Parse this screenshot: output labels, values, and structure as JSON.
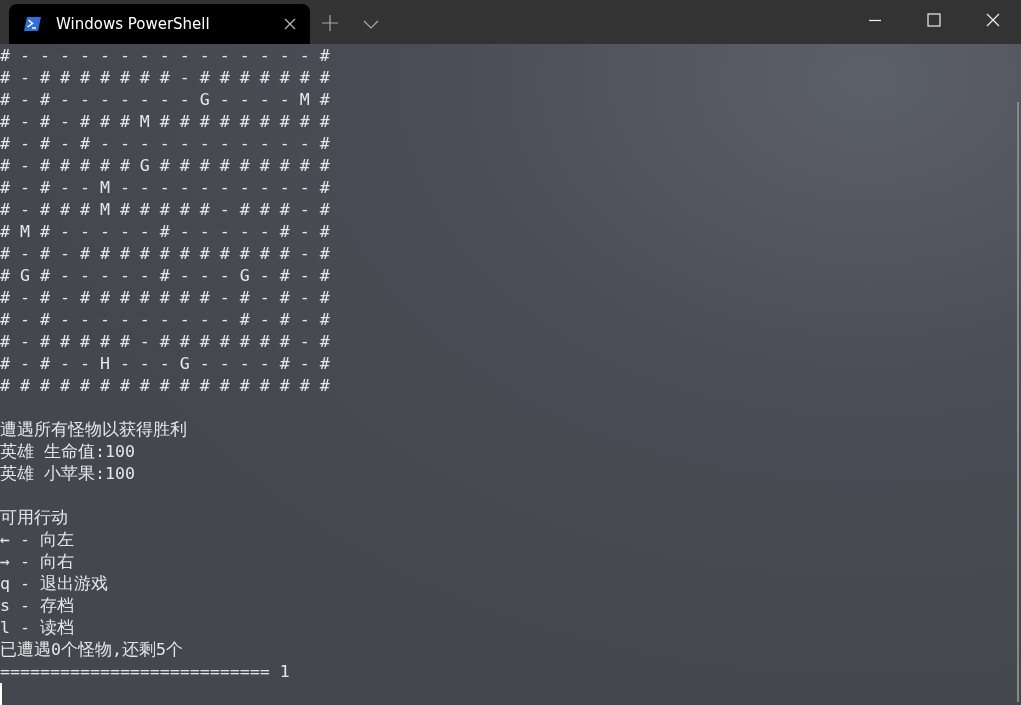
{
  "window": {
    "tabs": [
      {
        "title": "Windows PowerShell",
        "selected": true
      }
    ]
  },
  "terminal": {
    "blocks": [
      [
        "# - - - - - - - - - - - - - - - #",
        "# - # # # # # # # - # # # # # # #",
        "# - # - - - - - - - G - - - - M #",
        "# - # - # # # M # # # # # # # # #",
        "# - # - # - - - - - - - - - - - #",
        "# - # # # # # G # # # # # # # # #",
        "# - # - - M - - - - - - - - - - #",
        "# - # # # M # # # # # - # # # - #",
        "# M # - - - - - # - - - - - # - #",
        "# - # - # # # # # # # # # # # - #",
        "# G # - - - - - # - - - G - # - #",
        "# - # - # # # # # # # - # - # - #",
        "# - # - - - - - - - - - # - # - #",
        "# - # # # # # - # # # # # # # - #",
        "# - # - - H - - - G - - - - # - #",
        "# # # # # # # # # # # # # # # # #"
      ],
      [
        "遭遇所有怪物以获得胜利",
        "英雄 生命值:100",
        "英雄 小苹果:100"
      ],
      [
        "可用行动",
        "← - 向左",
        "→ - 向右",
        "q - 退出游戏",
        "s - 存档",
        "l - 读档",
        "已遭遇0个怪物,还剩5个",
        "=========================== 1"
      ]
    ],
    "cursor": true
  }
}
